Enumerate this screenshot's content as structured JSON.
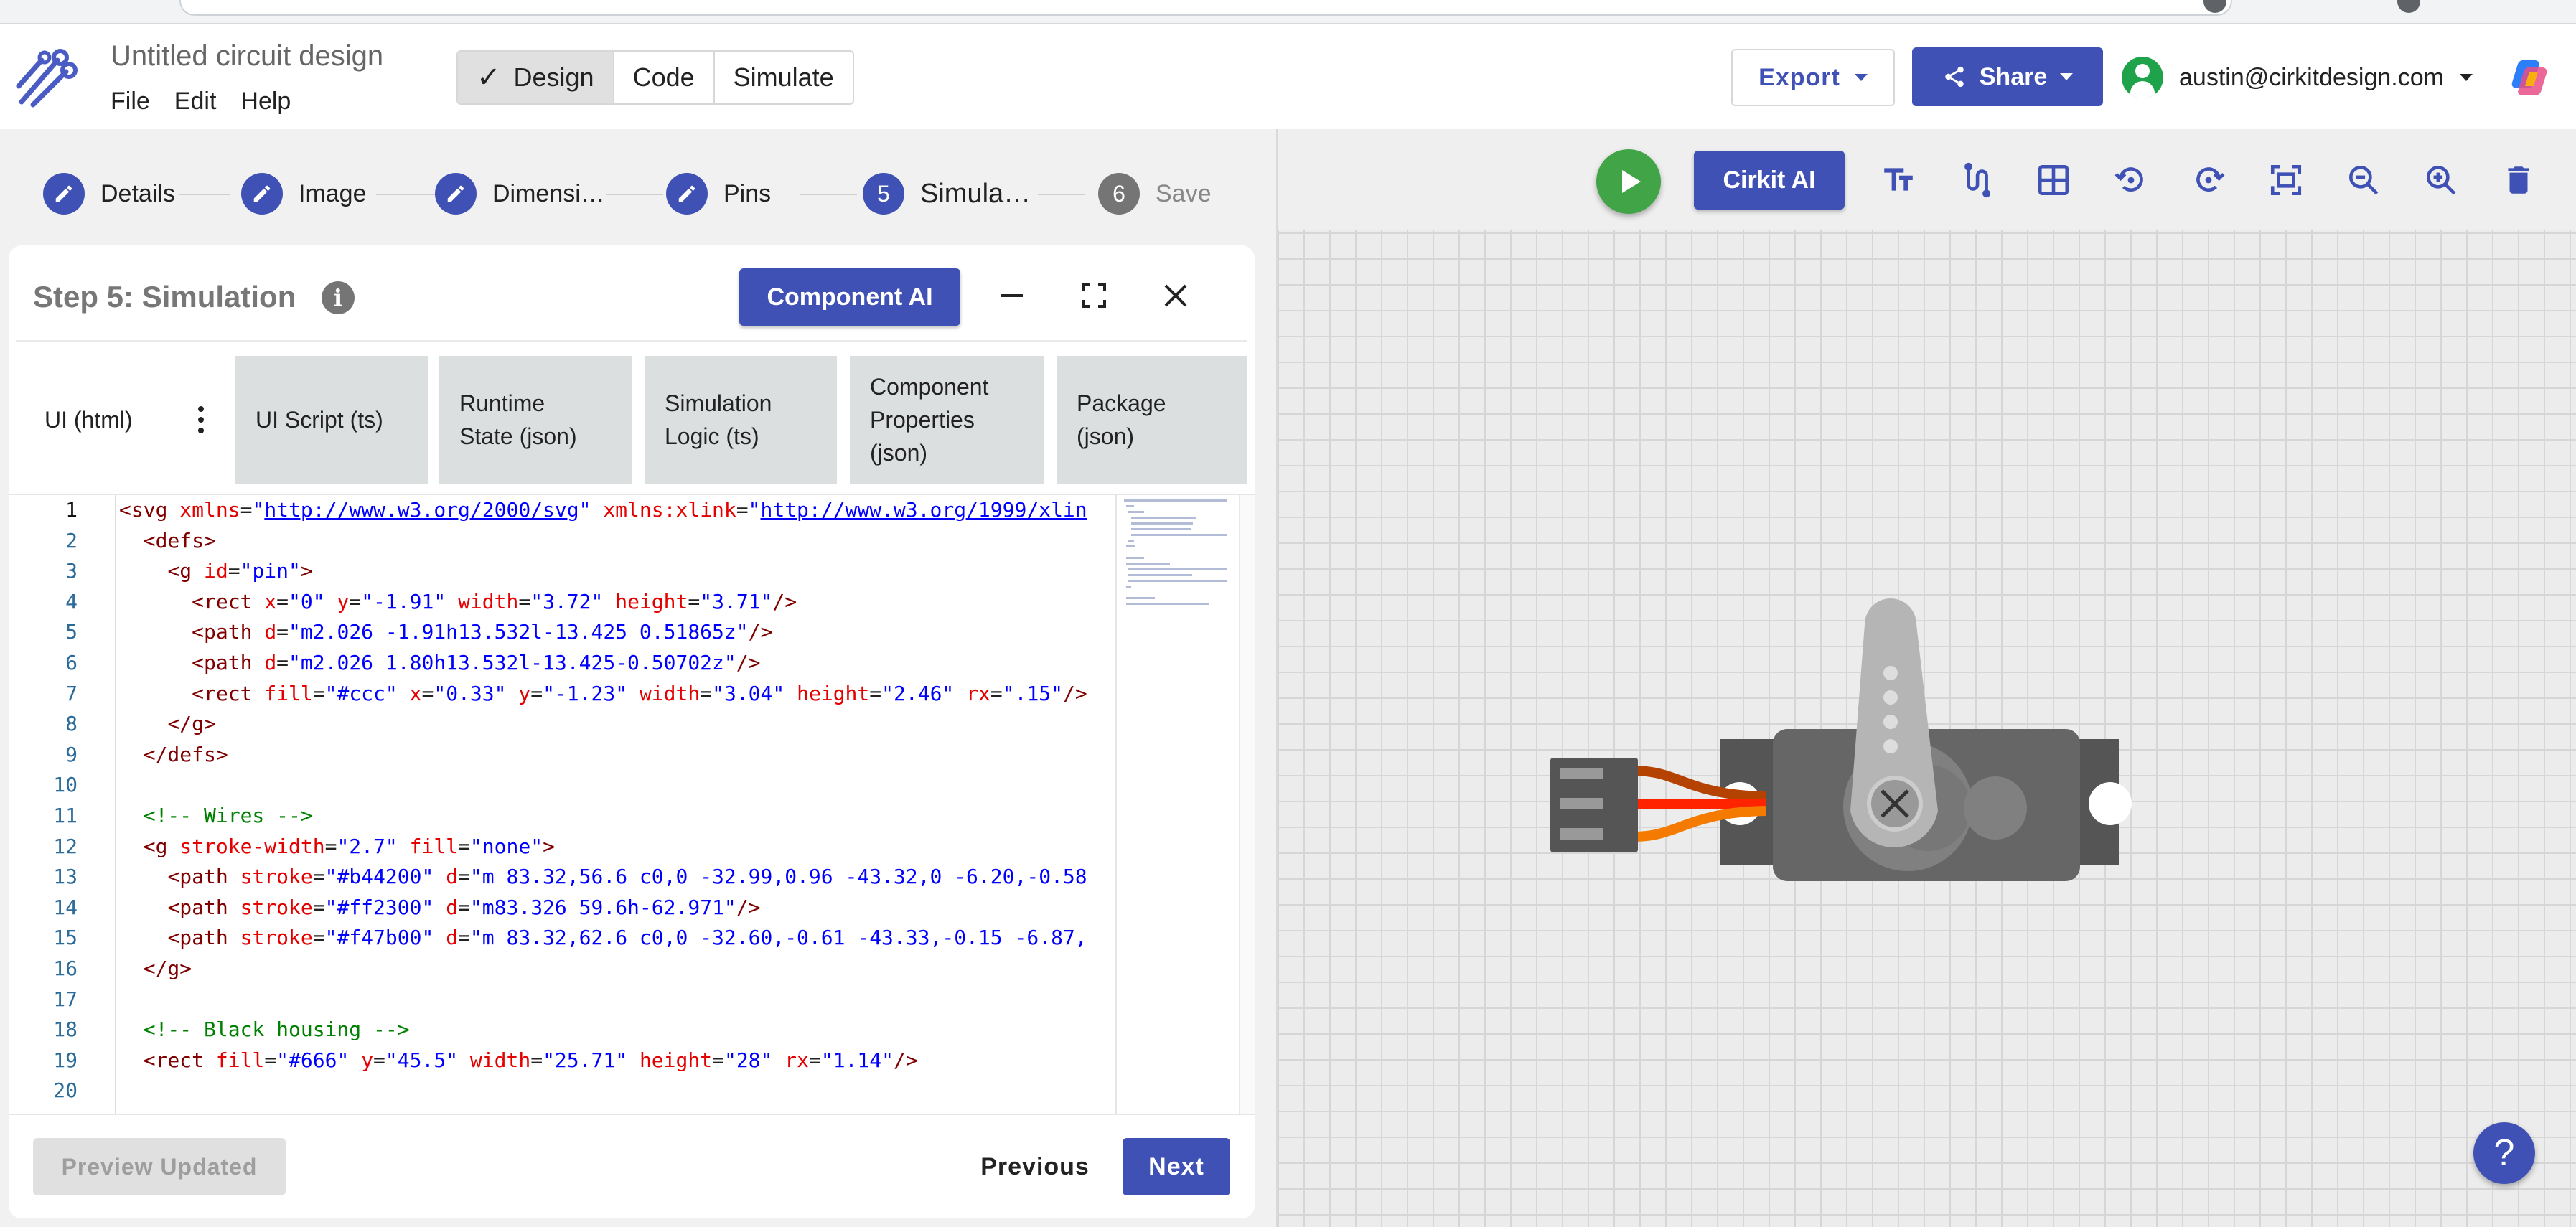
{
  "app": {
    "title": "Untitled circuit design",
    "menu": [
      "File",
      "Edit",
      "Help"
    ],
    "modes": [
      {
        "label": "Design",
        "active": true
      },
      {
        "label": "Code",
        "active": false
      },
      {
        "label": "Simulate",
        "active": false
      }
    ],
    "export_label": "Export",
    "share_label": "Share",
    "user_email": "austin@cirkitdesign.com",
    "accent_color": "#3f51b5",
    "play_color": "#41a446"
  },
  "stepper": {
    "steps": [
      {
        "label": "Details",
        "state": "done"
      },
      {
        "label": "Image",
        "state": "done"
      },
      {
        "label": "Dimensi…",
        "state": "done"
      },
      {
        "label": "Pins",
        "state": "done"
      },
      {
        "label": "Simula…",
        "state": "current",
        "number": "5"
      },
      {
        "label": "Save",
        "state": "future",
        "number": "6"
      }
    ]
  },
  "panel": {
    "title": "Step 5: Simulation",
    "info_icon_glyph": "i",
    "component_ai_label": "Component AI",
    "tabs": [
      {
        "label": "UI (html)",
        "active": true
      },
      {
        "label": "UI Script (ts)",
        "active": false
      },
      {
        "label": "Runtime State (json)",
        "active": false
      },
      {
        "label": "Simulation Logic (ts)",
        "active": false
      },
      {
        "label": "Component Properties (json)",
        "active": false
      },
      {
        "label": "Package (json)",
        "active": false
      }
    ],
    "code_lines": [
      "<svg xmlns=\"http://www.w3.org/2000/svg\" xmlns:xlink=\"http://www.w3.org/1999/xlin",
      "  <defs>",
      "    <g id=\"pin\">",
      "      <rect x=\"0\" y=\"-1.91\" width=\"3.72\" height=\"3.71\"/>",
      "      <path d=\"m2.026 -1.91h13.532l-13.425 0.51865z\"/>",
      "      <path d=\"m2.026 1.80h13.532l-13.425-0.50702z\"/>",
      "      <rect fill=\"#ccc\" x=\"0.33\" y=\"-1.23\" width=\"3.04\" height=\"2.46\" rx=\".15\"/>",
      "    </g>",
      "  </defs>",
      "",
      "  <!-- Wires -->",
      "  <g stroke-width=\"2.7\" fill=\"none\">",
      "    <path stroke=\"#b44200\" d=\"m 83.32,56.6 c0,0 -32.99,0.96 -43.32,0 -6.20,-0.58",
      "    <path stroke=\"#ff2300\" d=\"m83.326 59.6h-62.971\"/>",
      "    <path stroke=\"#f47b00\" d=\"m 83.32,62.6 c0,0 -32.60,-0.61 -43.33,-0.15 -6.87,",
      "  </g>",
      "",
      "  <!-- Black housing -->",
      "  <rect fill=\"#666\" y=\"45.5\" width=\"25.71\" height=\"28\" rx=\"1.14\"/>",
      ""
    ],
    "preview_label": "Preview Updated",
    "previous_label": "Previous",
    "next_label": "Next"
  },
  "canvas": {
    "cirkit_ai_label": "Cirkit AI",
    "tools": [
      "text-size-icon",
      "route-icon",
      "grid-icon",
      "rotate-left-icon",
      "rotate-right-icon",
      "fit-screen-icon",
      "zoom-out-icon",
      "zoom-in-icon",
      "delete-icon"
    ],
    "help_label": "?",
    "component": "servo-motor",
    "wire_colors": [
      "#b44200",
      "#ff2300",
      "#f47b00"
    ]
  }
}
